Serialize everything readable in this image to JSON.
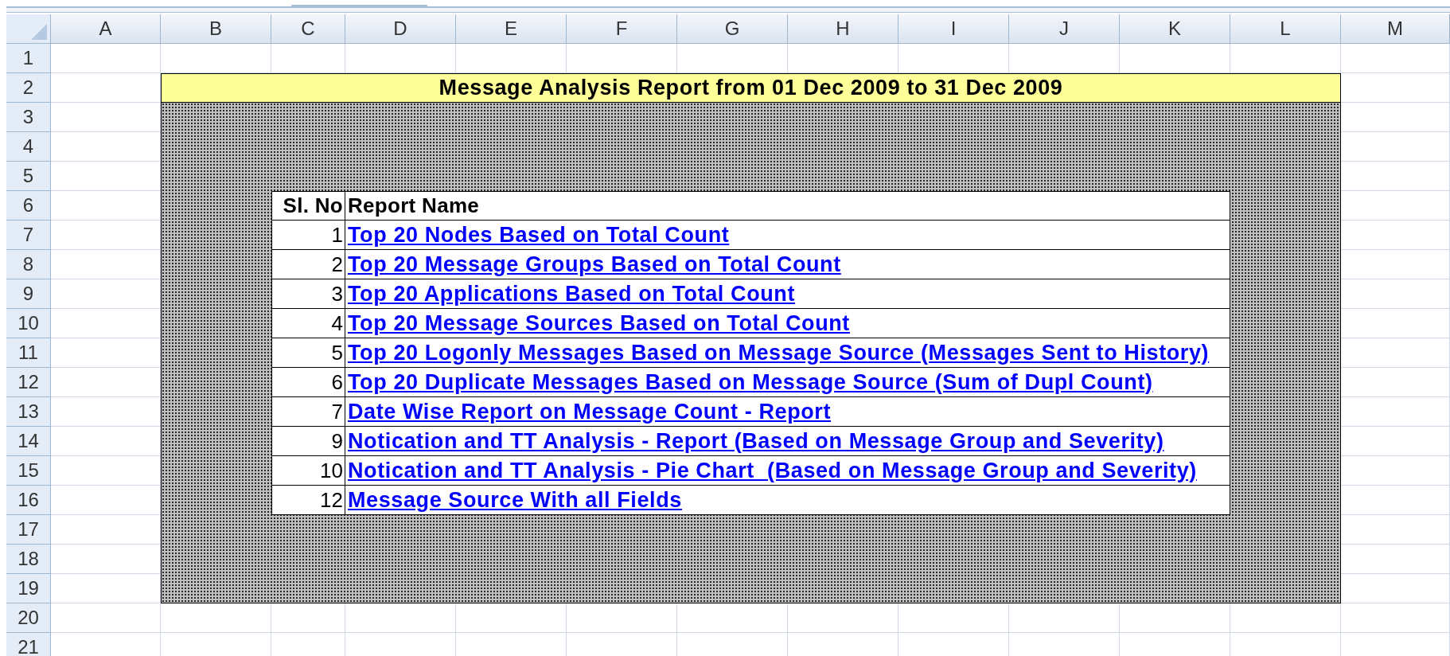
{
  "column_headers": [
    "A",
    "B",
    "C",
    "D",
    "E",
    "F",
    "G",
    "H",
    "I",
    "J",
    "K",
    "L",
    "M"
  ],
  "row_headers": [
    "1",
    "2",
    "3",
    "4",
    "5",
    "6",
    "7",
    "8",
    "9",
    "10",
    "11",
    "12",
    "13",
    "14",
    "15",
    "16",
    "17",
    "18",
    "19",
    "20",
    "21"
  ],
  "title": "Message Analysis Report from 01 Dec 2009 to 31 Dec 2009",
  "table": {
    "columns": [
      "Sl. No",
      "Report Name"
    ],
    "rows": [
      {
        "sl_no": "1",
        "report_name": "Top 20 Nodes Based on Total Count"
      },
      {
        "sl_no": "2",
        "report_name": "Top 20 Message Groups Based on Total Count"
      },
      {
        "sl_no": "3",
        "report_name": "Top 20 Applications Based on Total Count"
      },
      {
        "sl_no": "4",
        "report_name": "Top 20 Message Sources Based on Total Count"
      },
      {
        "sl_no": "5",
        "report_name": "Top 20 Logonly Messages Based on Message Source (Messages Sent to History)"
      },
      {
        "sl_no": "6",
        "report_name": "Top 20 Duplicate Messages Based on Message Source (Sum of Dupl Count)"
      },
      {
        "sl_no": "7",
        "report_name": "Date Wise Report on Message Count - Report"
      },
      {
        "sl_no": "9",
        "report_name": "Notication and TT Analysis - Report (Based on Message Group and Severity)"
      },
      {
        "sl_no": "10",
        "report_name": "Notication and TT Analysis - Pie Chart  (Based on Message Group and Severity)"
      },
      {
        "sl_no": "12",
        "report_name": "Message Source With all Fields"
      }
    ]
  }
}
